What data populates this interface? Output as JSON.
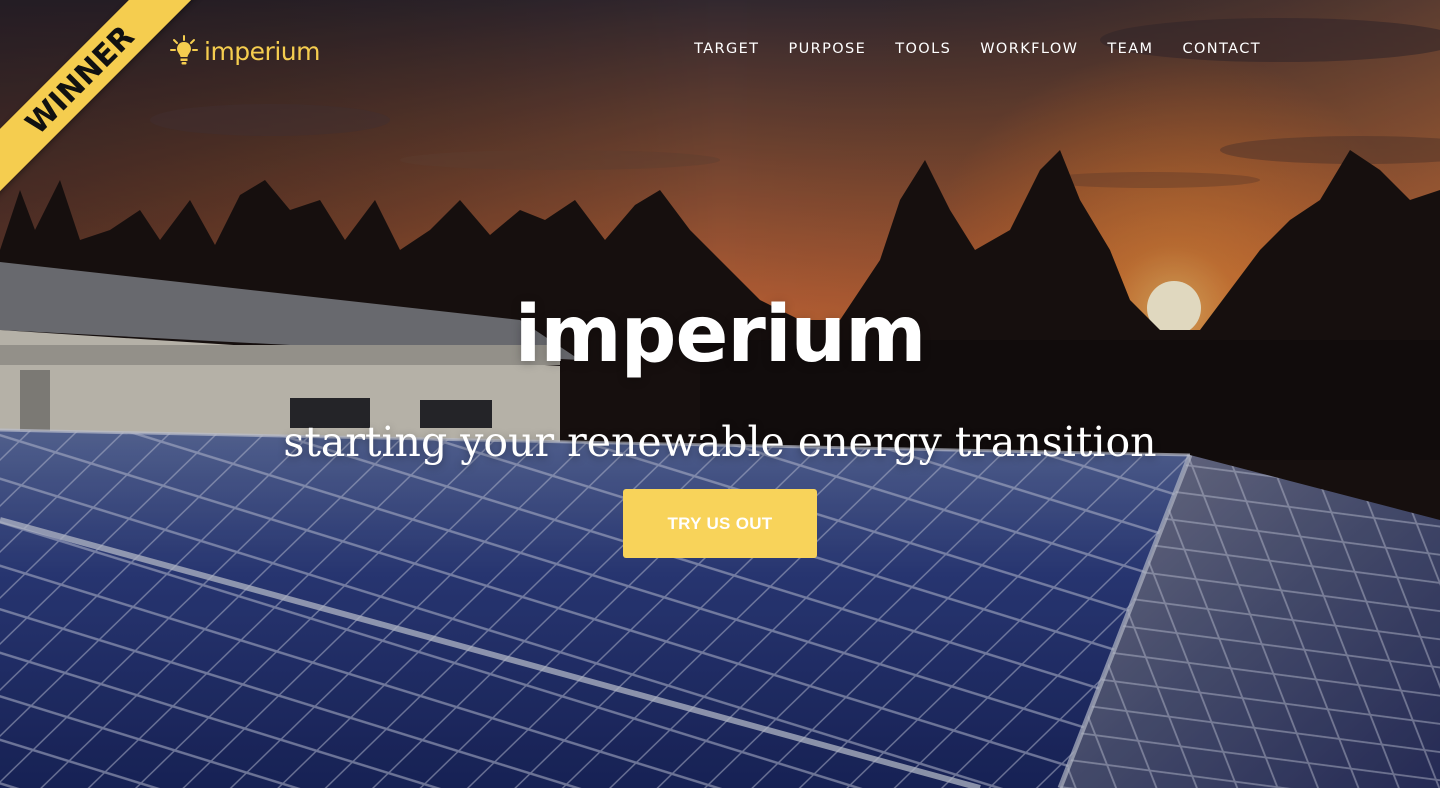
{
  "ribbon": {
    "label": "WINNER"
  },
  "brand": {
    "name": "imperium",
    "icon": "lightbulb-icon"
  },
  "nav": {
    "items": [
      "TARGET",
      "PURPOSE",
      "TOOLS",
      "WORKFLOW",
      "TEAM",
      "CONTACT"
    ]
  },
  "hero": {
    "title": "imperium",
    "subtitle": "starting your renewable energy transition",
    "cta_label": "TRY US OUT",
    "background": "sunset-solar-panels-photo"
  },
  "colors": {
    "accent": "#f5cd4f",
    "cta": "#f8d35a",
    "text": "#ffffff"
  }
}
